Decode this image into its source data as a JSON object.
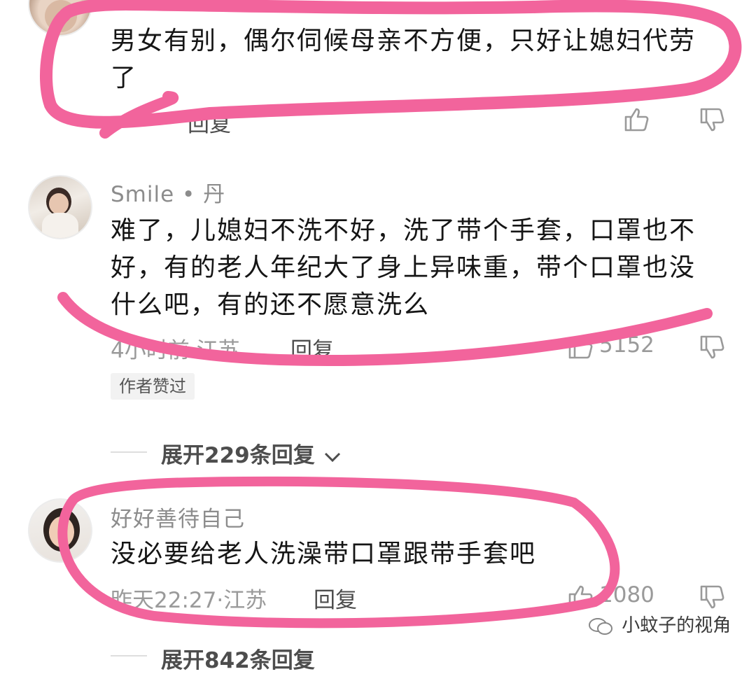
{
  "comment1": {
    "text_line1": "男女有别，偶尔伺候母亲不方便，只好让媳妇代劳",
    "text_line2": "了",
    "reply_label": "回复"
  },
  "comment2": {
    "username": "Smile • 丹",
    "text_line1": "难了，儿媳妇不洗不好，洗了带个手套，口罩也不",
    "text_line2": "好，有的老人年纪大了身上异味重，带个口罩也没",
    "text_line3": "什么吧，有的还不愿意洗么",
    "meta": "4小时前·江苏",
    "reply_label": "回复",
    "like_count": "5152",
    "author_badge": "作者赞过",
    "expand_label": "展开229条回复"
  },
  "comment3": {
    "username": "好好善待自己",
    "text": "没必要给老人洗澡带口罩跟带手套吧",
    "meta": "昨天22:27·江苏",
    "reply_label": "回复",
    "like_count": "1080",
    "expand_label": "展开842条回复"
  },
  "watermark": "小蚊子的视角",
  "colors": {
    "highlight": "#f2649c",
    "meta_gray": "#9a9a9a",
    "text": "#151515"
  }
}
